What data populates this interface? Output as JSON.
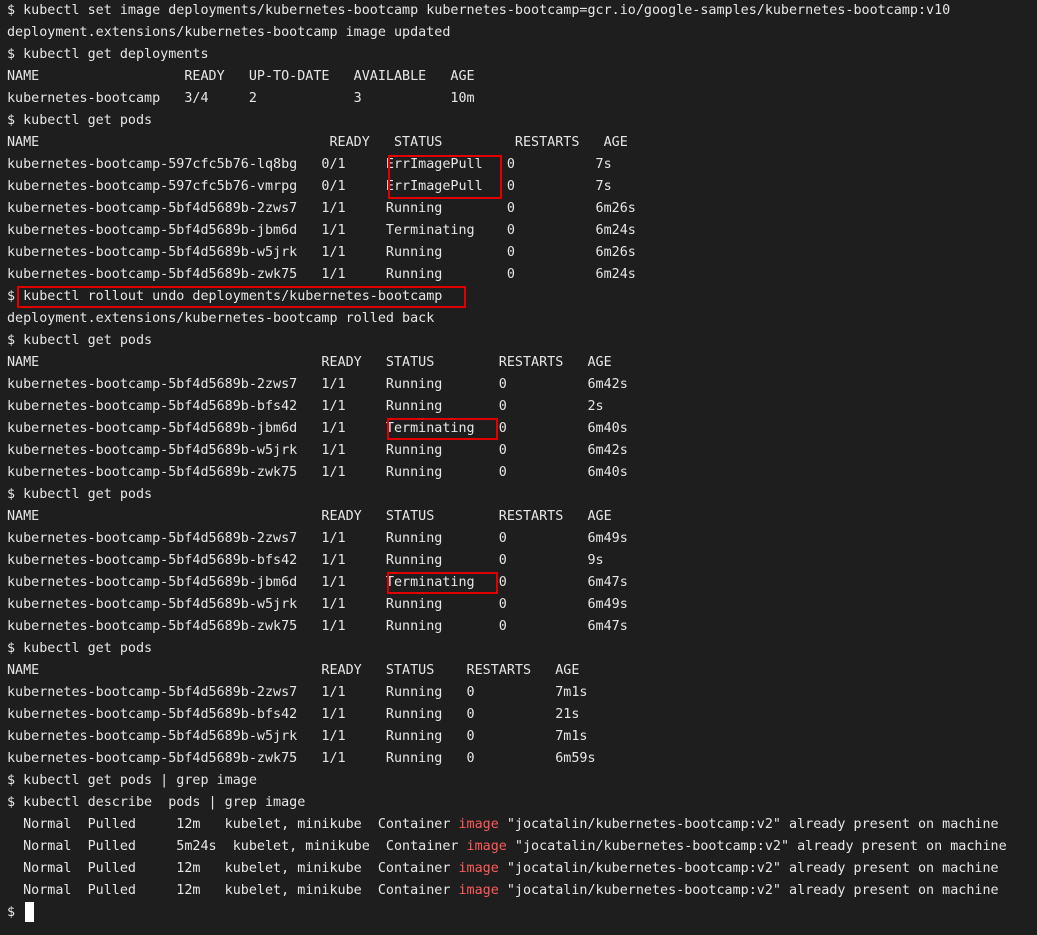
{
  "terminal": {
    "lines": [
      "$ kubectl set image deployments/kubernetes-bootcamp kubernetes-bootcamp=gcr.io/google-samples/kubernetes-bootcamp:v10",
      "deployment.extensions/kubernetes-bootcamp image updated",
      "$ kubectl get deployments",
      "NAME                  READY   UP-TO-DATE   AVAILABLE   AGE",
      "kubernetes-bootcamp   3/4     2            3           10m",
      "$ kubectl get pods",
      "NAME                                    READY   STATUS         RESTARTS   AGE",
      "kubernetes-bootcamp-597cfc5b76-lq8bg   0/1     ErrImagePull   0          7s",
      "kubernetes-bootcamp-597cfc5b76-vmrpg   0/1     ErrImagePull   0          7s",
      "kubernetes-bootcamp-5bf4d5689b-2zws7   1/1     Running        0          6m26s",
      "kubernetes-bootcamp-5bf4d5689b-jbm6d   1/1     Terminating    0          6m24s",
      "kubernetes-bootcamp-5bf4d5689b-w5jrk   1/1     Running        0          6m26s",
      "kubernetes-bootcamp-5bf4d5689b-zwk75   1/1     Running        0          6m24s",
      "$ kubectl rollout undo deployments/kubernetes-bootcamp",
      "deployment.extensions/kubernetes-bootcamp rolled back",
      "$ kubectl get pods",
      "NAME                                   READY   STATUS        RESTARTS   AGE",
      "kubernetes-bootcamp-5bf4d5689b-2zws7   1/1     Running       0          6m42s",
      "kubernetes-bootcamp-5bf4d5689b-bfs42   1/1     Running       0          2s",
      "kubernetes-bootcamp-5bf4d5689b-jbm6d   1/1     Terminating   0          6m40s",
      "kubernetes-bootcamp-5bf4d5689b-w5jrk   1/1     Running       0          6m42s",
      "kubernetes-bootcamp-5bf4d5689b-zwk75   1/1     Running       0          6m40s",
      "$ kubectl get pods",
      "NAME                                   READY   STATUS        RESTARTS   AGE",
      "kubernetes-bootcamp-5bf4d5689b-2zws7   1/1     Running       0          6m49s",
      "kubernetes-bootcamp-5bf4d5689b-bfs42   1/1     Running       0          9s",
      "kubernetes-bootcamp-5bf4d5689b-jbm6d   1/1     Terminating   0          6m47s",
      "kubernetes-bootcamp-5bf4d5689b-w5jrk   1/1     Running       0          6m49s",
      "kubernetes-bootcamp-5bf4d5689b-zwk75   1/1     Running       0          6m47s",
      "$ kubectl get pods",
      "NAME                                   READY   STATUS    RESTARTS   AGE",
      "kubernetes-bootcamp-5bf4d5689b-2zws7   1/1     Running   0          7m1s",
      "kubernetes-bootcamp-5bf4d5689b-bfs42   1/1     Running   0          21s",
      "kubernetes-bootcamp-5bf4d5689b-w5jrk   1/1     Running   0          7m1s",
      "kubernetes-bootcamp-5bf4d5689b-zwk75   1/1     Running   0          6m59s",
      "$ kubectl get pods | grep image",
      "$ kubectl describe  pods | grep image"
    ],
    "events": [
      {
        "pre": "  Normal  Pulled     12m   kubelet, minikube  Container ",
        "keyword": "image",
        "post": " \"jocatalin/kubernetes-bootcamp:v2\" already present on machine"
      },
      {
        "pre": "  Normal  Pulled     5m24s  kubelet, minikube  Container ",
        "keyword": "image",
        "post": " \"jocatalin/kubernetes-bootcamp:v2\" already present on machine"
      },
      {
        "pre": "  Normal  Pulled     12m   kubelet, minikube  Container ",
        "keyword": "image",
        "post": " \"jocatalin/kubernetes-bootcamp:v2\" already present on machine"
      },
      {
        "pre": "  Normal  Pulled     12m   kubelet, minikube  Container ",
        "keyword": "image",
        "post": " \"jocatalin/kubernetes-bootcamp:v2\" already present on machine"
      }
    ],
    "prompt": "$ ",
    "colors": {
      "background": "#1e1e1e",
      "foreground": "#e6e6e6",
      "grep_highlight": "#ff5a5a",
      "annotation_box": "#e00000",
      "cursor": "#ffffff"
    }
  }
}
